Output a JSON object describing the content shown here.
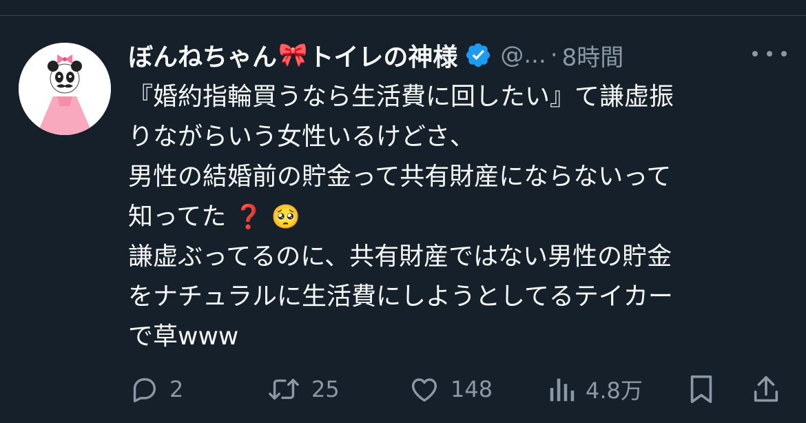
{
  "tweet": {
    "display_name": "ぼんねちゃん",
    "name_emoji": "🎀",
    "display_name_suffix": "トイレの神様",
    "handle": "@...",
    "separator": "·",
    "time": "8時間",
    "lines": [
      "『婚約指輪買うなら生活費に回したい』て謙虚振",
      "りながらいう女性いるけどさ、",
      "男性の結婚前の貯金って共有財産にならないって",
      "知ってた",
      "謙虚ぶってるのに、共有財産ではない男性の貯金",
      "をナチュラルに生活費にしようとしてるテイカー",
      "で草www"
    ],
    "emoji_question": "❓",
    "emoji_pleading": "🥺"
  },
  "actions": {
    "replies": "2",
    "retweets": "25",
    "likes": "148",
    "views": "4.8万"
  },
  "colors": {
    "background": "#15202b",
    "text": "#f7f9f9",
    "muted": "#8b98a5",
    "verified": "#1d9bf0"
  }
}
